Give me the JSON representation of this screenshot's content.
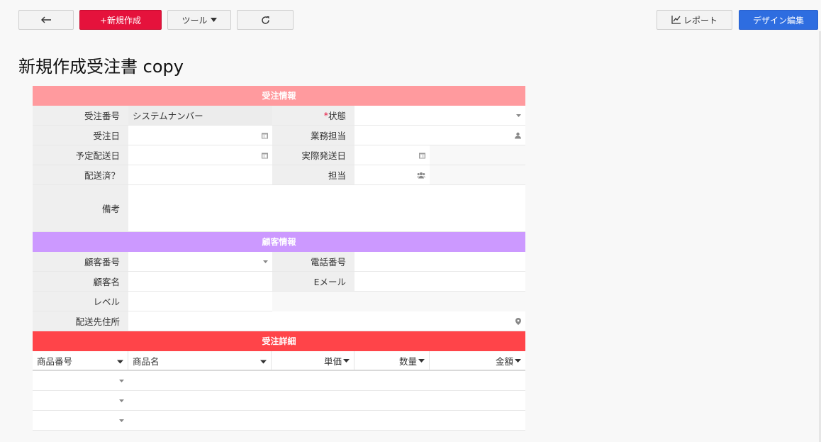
{
  "toolbar": {
    "new_label": "+新規作成",
    "tools_label": "ツール",
    "report_label": "レポート",
    "design_label": "デザイン編集"
  },
  "page": {
    "title": "新規作成受注書 copy"
  },
  "sections": {
    "order_info": {
      "title": "受注情報",
      "color": "#ff9a9e"
    },
    "customer_info": {
      "title": "顧客情報",
      "color": "#cc99ff"
    },
    "order_detail": {
      "title": "受注詳細",
      "color": "#ff4449"
    }
  },
  "order_fields": {
    "order_no_label": "受注番号",
    "order_no_value": "システムナンバー",
    "status_required": "*",
    "status_label": "状態",
    "order_date_label": "受注日",
    "staff_label": "業務担当",
    "planned_ship_label": "予定配送日",
    "actual_ship_label": "実際発送日",
    "shipped_label": "配送済？",
    "assignee_label": "担当",
    "remarks_label": "備考"
  },
  "customer_fields": {
    "customer_no_label": "顧客番号",
    "phone_label": "電話番号",
    "customer_name_label": "顧客名",
    "email_label": "Eメール",
    "level_label": "レベル",
    "address_label": "配送先住所"
  },
  "detail_table": {
    "columns": [
      "商品番号",
      "商品名",
      "単価",
      "数量",
      "金額"
    ],
    "empty_rows": 3
  }
}
